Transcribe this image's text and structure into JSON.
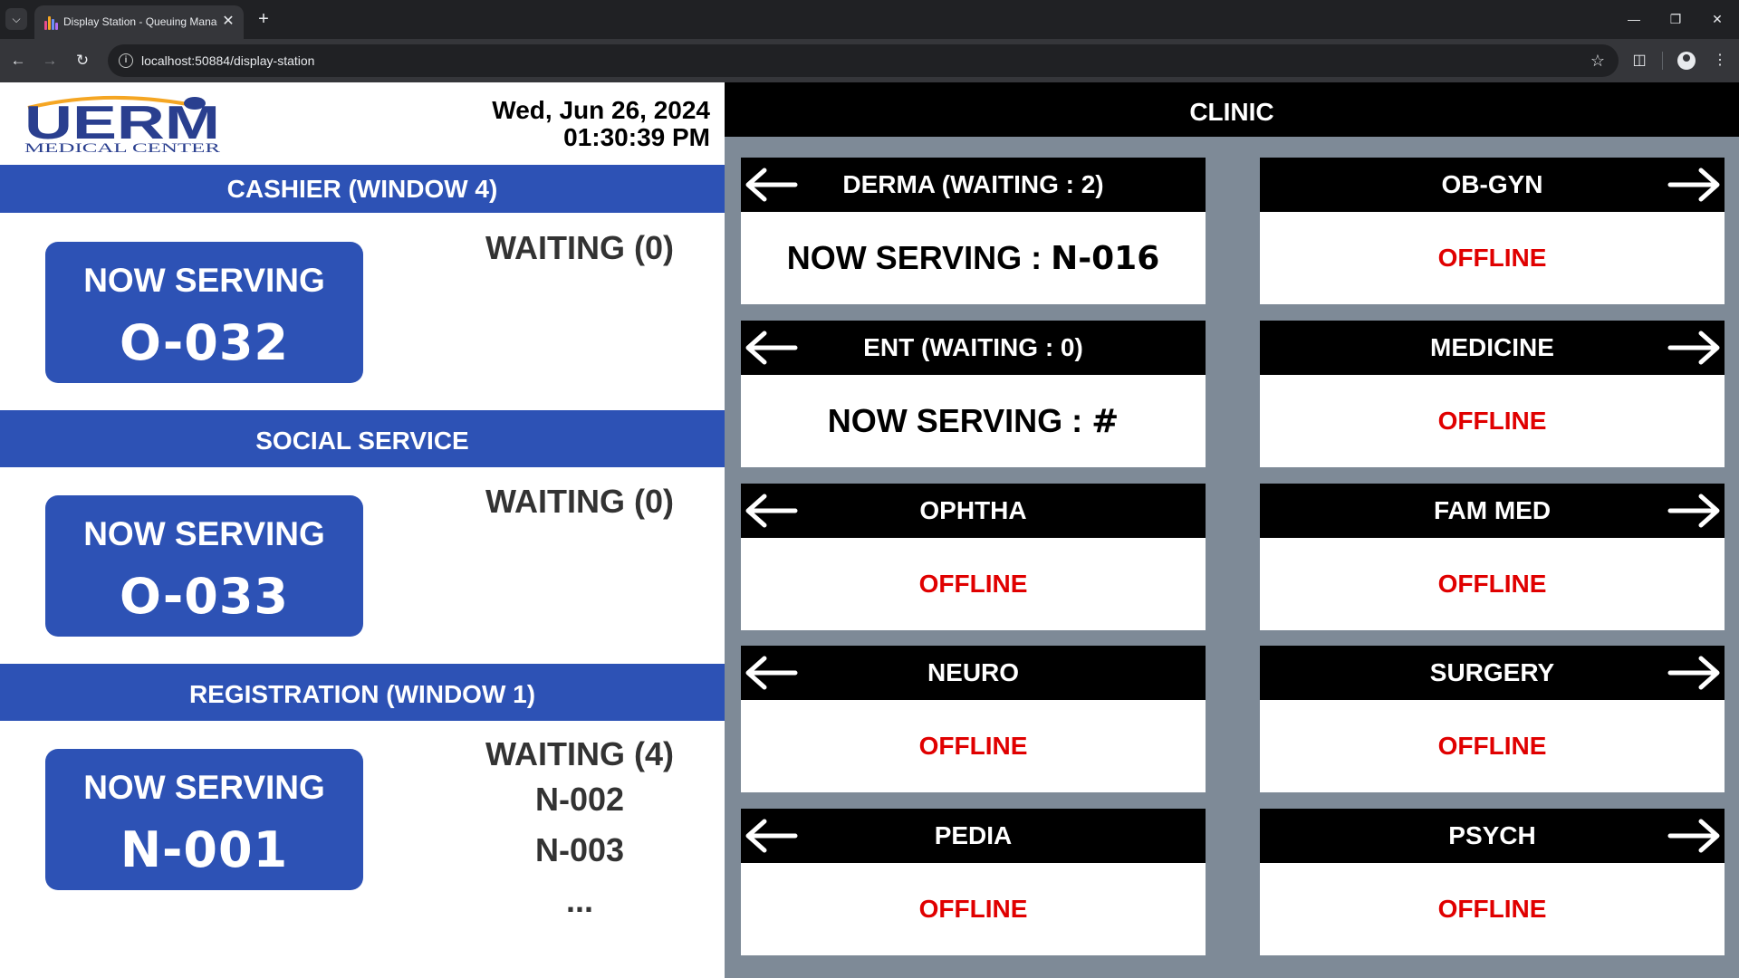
{
  "browser": {
    "tab_title": "Display Station - Queuing Management",
    "url": "localhost:50884/display-station"
  },
  "header": {
    "logo_text": "UERM",
    "logo_subtext": "MEDICAL CENTER",
    "date": "Wed, Jun 26, 2024",
    "time": "01:30:39 PM"
  },
  "services": [
    {
      "name": "CASHIER (WINDOW 4)",
      "now_serving_label": "NOW SERVING",
      "now_serving_number": "O-032",
      "waiting_label": "WAITING (0)",
      "queue": []
    },
    {
      "name": "SOCIAL SERVICE",
      "now_serving_label": "NOW SERVING",
      "now_serving_number": "O-033",
      "waiting_label": "WAITING (0)",
      "queue": []
    },
    {
      "name": "REGISTRATION (WINDOW 1)",
      "now_serving_label": "NOW SERVING",
      "now_serving_number": "N-001",
      "waiting_label": "WAITING (4)",
      "queue": [
        "N-002",
        "N-003",
        "..."
      ]
    }
  ],
  "clinic": {
    "title": "CLINIC",
    "left_column": [
      {
        "header": "DERMA (WAITING : 2)",
        "status": "serving",
        "serving_prefix": "NOW SERVING : ",
        "serving_number": "N-016"
      },
      {
        "header": "ENT (WAITING : 0)",
        "status": "serving",
        "serving_prefix": "NOW SERVING : ",
        "serving_number": "#"
      },
      {
        "header": "OPHTHA",
        "status": "offline",
        "status_text": "OFFLINE"
      },
      {
        "header": "NEURO",
        "status": "offline",
        "status_text": "OFFLINE"
      },
      {
        "header": "PEDIA",
        "status": "offline",
        "status_text": "OFFLINE"
      }
    ],
    "right_column": [
      {
        "header": "OB-GYN",
        "status": "offline",
        "status_text": "OFFLINE"
      },
      {
        "header": "MEDICINE",
        "status": "offline",
        "status_text": "OFFLINE"
      },
      {
        "header": "FAM MED",
        "status": "offline",
        "status_text": "OFFLINE"
      },
      {
        "header": "SURGERY",
        "status": "offline",
        "status_text": "OFFLINE"
      },
      {
        "header": "PSYCH",
        "status": "offline",
        "status_text": "OFFLINE"
      }
    ]
  },
  "colors": {
    "service_blue": "#2d52b5",
    "clinic_bg": "#7e8a97",
    "offline_red": "#e00000",
    "logo_orange": "#f5a623"
  },
  "icons": [
    "chevron-down-icon",
    "favicon-icon",
    "close-icon",
    "plus-icon",
    "minimize-icon",
    "restore-icon",
    "back-icon",
    "forward-icon",
    "reload-icon",
    "site-info-icon",
    "star-icon",
    "extensions-icon",
    "profile-icon",
    "menu-icon",
    "arrow-left-icon",
    "arrow-right-icon"
  ]
}
